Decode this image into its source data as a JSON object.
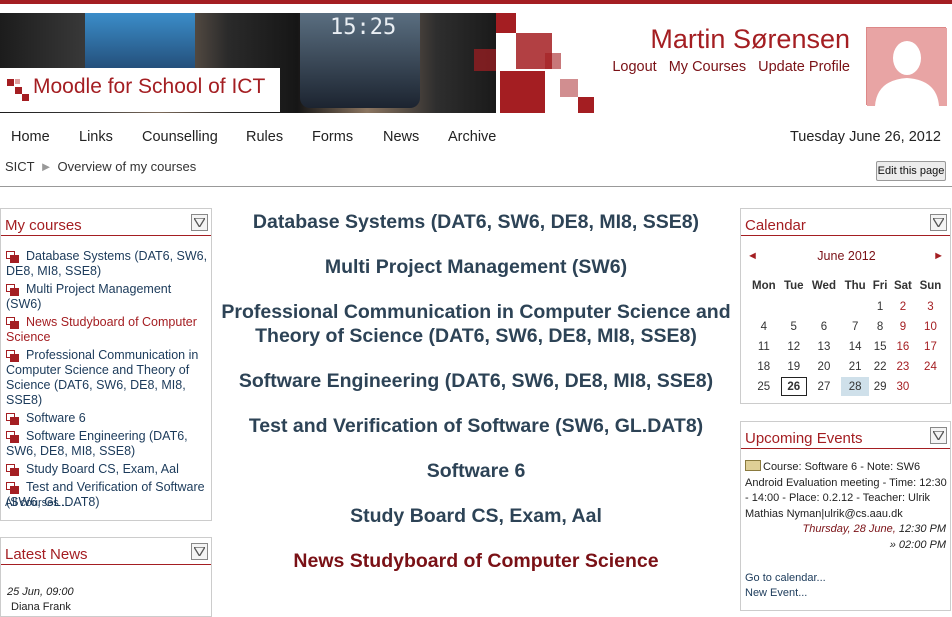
{
  "header": {
    "logo_text": "Moodle for School of ICT",
    "phone_clock": "15:25",
    "user_name": "Martin Sørensen",
    "user_links": [
      "Logout",
      "My Courses",
      "Update Profile"
    ]
  },
  "nav": {
    "items": [
      "Home",
      "Links",
      "Counselling",
      "Rules",
      "Forms",
      "News",
      "Archive"
    ],
    "date": "Tuesday June 26, 2012"
  },
  "breadcrumb": {
    "root": "SICT",
    "separator": "►",
    "current": "Overview of my courses"
  },
  "edit_button": "Edit this page",
  "my_courses": {
    "title": "My courses",
    "items": [
      "Database Systems (DAT6, SW6, DE8, MI8, SSE8)",
      "Multi Project Management (SW6)",
      "News Studyboard of Computer Science",
      "Professional Communication in Computer Science and Theory of Science (DAT6, SW6, DE8, MI8, SSE8)",
      "Software 6",
      "Software Engineering (DAT6, SW6, DE8, MI8, SSE8)",
      "Study Board CS, Exam, Aal",
      "Test and Verification of Software (SW6, GL.DAT8)"
    ],
    "all_courses": "All courses ..."
  },
  "latest_news": {
    "title": "Latest News",
    "date": "25 Jun, 09:00",
    "author": "Diana Frank"
  },
  "main": {
    "courses": [
      "Database Systems (DAT6, SW6, DE8, MI8, SSE8)",
      "Multi Project Management (SW6)",
      "Professional Communication in Computer Science and Theory of Science (DAT6, SW6, DE8, MI8, SSE8)",
      "Software Engineering (DAT6, SW6, DE8, MI8, SSE8)",
      "Test and Verification of Software (SW6, GL.DAT8)",
      "Software 6",
      "Study Board CS, Exam, Aal",
      "News Studyboard of Computer Science"
    ]
  },
  "calendar": {
    "title": "Calendar",
    "month": "June 2012",
    "prev": "◄",
    "next": "►",
    "days": [
      "Mon",
      "Tue",
      "Wed",
      "Thu",
      "Fri",
      "Sat",
      "Sun"
    ],
    "weeks": [
      [
        "",
        "",
        "",
        "",
        "1",
        "2",
        "3"
      ],
      [
        "4",
        "5",
        "6",
        "7",
        "8",
        "9",
        "10"
      ],
      [
        "11",
        "12",
        "13",
        "14",
        "15",
        "16",
        "17"
      ],
      [
        "18",
        "19",
        "20",
        "21",
        "22",
        "23",
        "24"
      ],
      [
        "25",
        "26",
        "27",
        "28",
        "29",
        "30",
        ""
      ]
    ],
    "today": "26",
    "event_day": "28"
  },
  "upcoming_events": {
    "title": "Upcoming Events",
    "event": "Course: Software 6 - Note: SW6 Android Evaluation meeting - Time: 12:30 - 14:00 - Place: 0.2.12 - Teacher: Ulrik Mathias Nyman|ulrik@cs.aau.dk",
    "when_date": "Thursday, 28 June,",
    "when_start": "12:30 PM",
    "when_end": "» 02:00 PM",
    "calendar_link": "Go to calendar...",
    "new_event_link": "New Event..."
  },
  "colors": {
    "brand": "#a41e22",
    "course_link": "#2d4356",
    "event_day": "#cfe0ea"
  }
}
